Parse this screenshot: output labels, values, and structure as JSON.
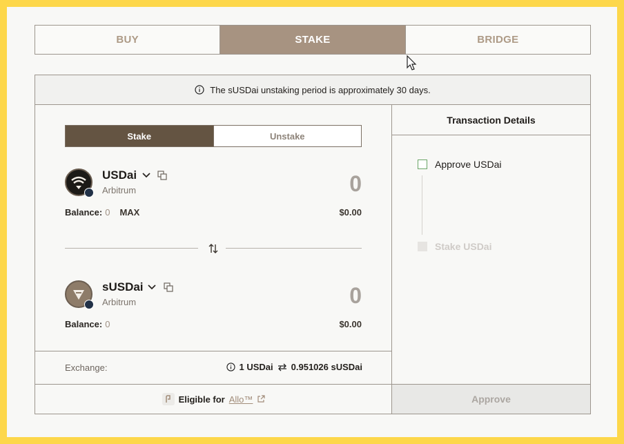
{
  "tabs": [
    "BUY",
    "STAKE",
    "BRIDGE"
  ],
  "notice": "The sUSDai unstaking period is approximately 30 days.",
  "toggle": {
    "stake": "Stake",
    "unstake": "Unstake"
  },
  "from_token": {
    "name": "USDai",
    "chain": "Arbitrum",
    "amount": "0",
    "balance_label": "Balance:",
    "balance_value": "0",
    "max_label": "MAX",
    "usd_value": "$0.00"
  },
  "to_token": {
    "name": "sUSDai",
    "chain": "Arbitrum",
    "amount": "0",
    "balance_label": "Balance:",
    "balance_value": "0",
    "usd_value": "$0.00"
  },
  "exchange": {
    "label": "Exchange:",
    "from": "1 USDai",
    "to": "0.951026 sUSDai"
  },
  "eligible": {
    "text": "Eligible for",
    "link": "Allo™"
  },
  "transaction": {
    "title": "Transaction Details",
    "steps": [
      "Approve USDai",
      "Stake USDai"
    ],
    "button": "Approve"
  },
  "colors": {
    "accent": "#a79381",
    "toggle_active": "#645442",
    "background": "#fdd74a"
  }
}
